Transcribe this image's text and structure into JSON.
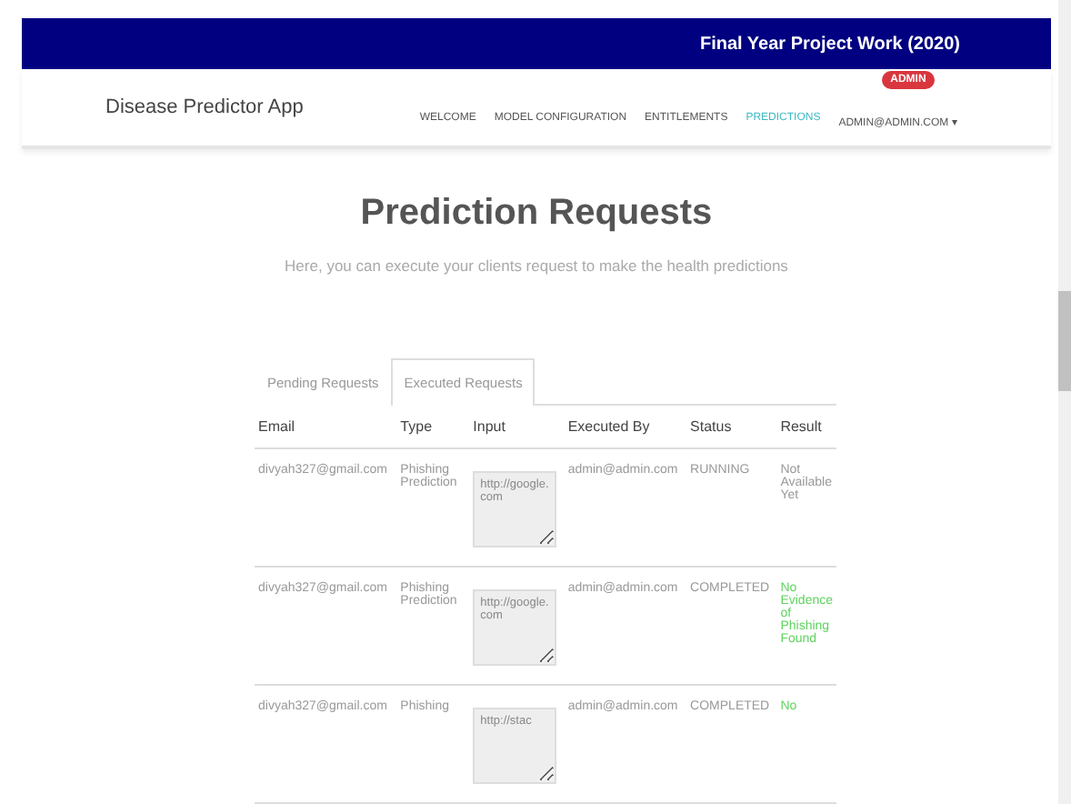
{
  "banner": {
    "title": "Final Year Project Work (2020)"
  },
  "navbar": {
    "brand": "Disease Predictor App",
    "badge": "ADMIN",
    "links": [
      {
        "label": "WELCOME",
        "selected": false
      },
      {
        "label": "MODEL CONFIGURATION",
        "selected": false
      },
      {
        "label": "ENTITLEMENTS",
        "selected": false
      },
      {
        "label": "PREDICTIONS",
        "selected": true
      },
      {
        "label": "ADMIN@ADMIN.COM ▾",
        "selected": false
      }
    ]
  },
  "heading": "Prediction Requests",
  "subtitle": "Here, you can execute your clients request to make the health predictions",
  "tabs": [
    {
      "label": "Pending Requests",
      "selected": false
    },
    {
      "label": "Executed Requests",
      "selected": true
    }
  ],
  "table": {
    "columns": [
      "Email",
      "Type",
      "Input",
      "Executed By",
      "Status",
      "Result"
    ],
    "rows": [
      {
        "email": "divyah327@gmail.com",
        "type": "Phishing Prediction",
        "input": "http://google.com",
        "executed_by": "admin@admin.com",
        "status": "RUNNING",
        "result": "Not Available Yet",
        "color": "#999999"
      },
      {
        "email": "divyah327@gmail.com",
        "type": "Phishing Prediction",
        "input": "http://google.com",
        "executed_by": "admin@admin.com",
        "status": "COMPLETED",
        "result": "No Evidence of Phishing Found",
        "color": "#5fd35f"
      },
      {
        "email": "divyah327@gmail.com",
        "type": "Phishing",
        "input": "http://stac",
        "executed_by": "admin@admin.com",
        "status": "COMPLETED",
        "result": "No",
        "color": "#5fd35f"
      }
    ]
  }
}
